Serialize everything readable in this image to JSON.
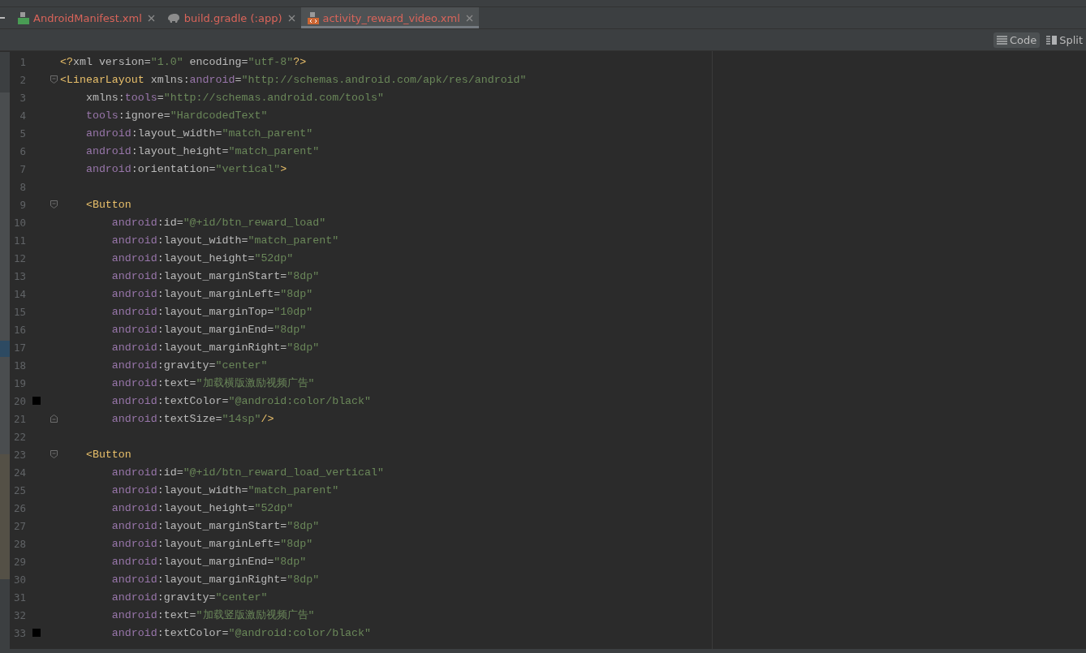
{
  "tabs": [
    {
      "label": "AndroidManifest.xml",
      "kind": "manifest",
      "selected": false
    },
    {
      "label": "build.gradle (:app)",
      "kind": "gradle",
      "selected": false
    },
    {
      "label": "activity_reward_video.xml",
      "kind": "xml",
      "selected": true
    }
  ],
  "view_modes": [
    {
      "label": "Code",
      "kind": "code",
      "selected": true
    },
    {
      "label": "Split",
      "kind": "split",
      "selected": false
    }
  ],
  "lines": [
    {
      "number": "1",
      "tokens": [
        {
          "kind": "punct",
          "text": "<?"
        },
        {
          "kind": "attr",
          "text": "xml version"
        },
        {
          "kind": "eq",
          "text": "="
        },
        {
          "kind": "value",
          "text": "\"1.0\""
        },
        {
          "kind": "attr",
          "text": " encoding"
        },
        {
          "kind": "eq",
          "text": "="
        },
        {
          "kind": "value",
          "text": "\"utf-8\""
        },
        {
          "kind": "punct",
          "text": "?>"
        }
      ]
    },
    {
      "number": "2",
      "fold_start": true,
      "tokens": [
        {
          "kind": "punct",
          "text": "<"
        },
        {
          "kind": "tag",
          "text": "LinearLayout"
        },
        {
          "kind": "attr",
          "text": " xmlns:"
        },
        {
          "kind": "ns",
          "text": "android"
        },
        {
          "kind": "eq",
          "text": "="
        },
        {
          "kind": "value",
          "text": "\"http://schemas.android.com/apk/res/android\""
        }
      ]
    },
    {
      "number": "3",
      "tokens": [
        {
          "kind": "attr",
          "text": "    xmlns:"
        },
        {
          "kind": "ns",
          "text": "tools"
        },
        {
          "kind": "eq",
          "text": "="
        },
        {
          "kind": "value",
          "text": "\"http://schemas.android.com/tools\""
        }
      ]
    },
    {
      "number": "4",
      "tokens": [
        {
          "kind": "ns",
          "text": "    tools"
        },
        {
          "kind": "attr",
          "text": ":ignore"
        },
        {
          "kind": "eq",
          "text": "="
        },
        {
          "kind": "value",
          "text": "\"HardcodedText\""
        }
      ]
    },
    {
      "number": "5",
      "tokens": [
        {
          "kind": "ns",
          "text": "    android"
        },
        {
          "kind": "attr",
          "text": ":layout_width"
        },
        {
          "kind": "eq",
          "text": "="
        },
        {
          "kind": "value",
          "text": "\"match_parent\""
        }
      ]
    },
    {
      "number": "6",
      "tokens": [
        {
          "kind": "ns",
          "text": "    android"
        },
        {
          "kind": "attr",
          "text": ":layout_height"
        },
        {
          "kind": "eq",
          "text": "="
        },
        {
          "kind": "value",
          "text": "\"match_parent\""
        }
      ]
    },
    {
      "number": "7",
      "tokens": [
        {
          "kind": "ns",
          "text": "    android"
        },
        {
          "kind": "attr",
          "text": ":orientation"
        },
        {
          "kind": "eq",
          "text": "="
        },
        {
          "kind": "value",
          "text": "\"vertical\""
        },
        {
          "kind": "punct",
          "text": ">"
        }
      ]
    },
    {
      "number": "8"
    },
    {
      "number": "9",
      "fold_start": true,
      "tokens": [
        {
          "kind": "punct",
          "text": "    <"
        },
        {
          "kind": "tag",
          "text": "Button"
        }
      ]
    },
    {
      "number": "10",
      "tokens": [
        {
          "kind": "ns",
          "text": "        android"
        },
        {
          "kind": "attr",
          "text": ":id"
        },
        {
          "kind": "eq",
          "text": "="
        },
        {
          "kind": "value",
          "text": "\"@+id/btn_reward_load\""
        }
      ]
    },
    {
      "number": "11",
      "tokens": [
        {
          "kind": "ns",
          "text": "        android"
        },
        {
          "kind": "attr",
          "text": ":layout_width"
        },
        {
          "kind": "eq",
          "text": "="
        },
        {
          "kind": "value",
          "text": "\"match_parent\""
        }
      ]
    },
    {
      "number": "12",
      "tokens": [
        {
          "kind": "ns",
          "text": "        android"
        },
        {
          "kind": "attr",
          "text": ":layout_height"
        },
        {
          "kind": "eq",
          "text": "="
        },
        {
          "kind": "value",
          "text": "\"52dp\""
        }
      ]
    },
    {
      "number": "13",
      "tokens": [
        {
          "kind": "ns",
          "text": "        android"
        },
        {
          "kind": "attr",
          "text": ":layout_marginStart"
        },
        {
          "kind": "eq",
          "text": "="
        },
        {
          "kind": "value",
          "text": "\"8dp\""
        }
      ]
    },
    {
      "number": "14",
      "tokens": [
        {
          "kind": "ns",
          "text": "        android"
        },
        {
          "kind": "attr",
          "text": ":layout_marginLeft"
        },
        {
          "kind": "eq",
          "text": "="
        },
        {
          "kind": "value",
          "text": "\"8dp\""
        }
      ]
    },
    {
      "number": "15",
      "tokens": [
        {
          "kind": "ns",
          "text": "        android"
        },
        {
          "kind": "attr",
          "text": ":layout_marginTop"
        },
        {
          "kind": "eq",
          "text": "="
        },
        {
          "kind": "value",
          "text": "\"10dp\""
        }
      ]
    },
    {
      "number": "16",
      "tokens": [
        {
          "kind": "ns",
          "text": "        android"
        },
        {
          "kind": "attr",
          "text": ":layout_marginEnd"
        },
        {
          "kind": "eq",
          "text": "="
        },
        {
          "kind": "value",
          "text": "\"8dp\""
        }
      ]
    },
    {
      "number": "17",
      "tokens": [
        {
          "kind": "ns",
          "text": "        android"
        },
        {
          "kind": "attr",
          "text": ":layout_marginRight"
        },
        {
          "kind": "eq",
          "text": "="
        },
        {
          "kind": "value",
          "text": "\"8dp\""
        }
      ]
    },
    {
      "number": "18",
      "tokens": [
        {
          "kind": "ns",
          "text": "        android"
        },
        {
          "kind": "attr",
          "text": ":gravity"
        },
        {
          "kind": "eq",
          "text": "="
        },
        {
          "kind": "value",
          "text": "\"center\""
        }
      ]
    },
    {
      "number": "19",
      "tokens": [
        {
          "kind": "ns",
          "text": "        android"
        },
        {
          "kind": "attr",
          "text": ":text"
        },
        {
          "kind": "eq",
          "text": "="
        },
        {
          "kind": "value",
          "text": "\"加载横版激励视频广告\""
        }
      ]
    },
    {
      "number": "20",
      "color": "#000000",
      "tokens": [
        {
          "kind": "ns",
          "text": "        android"
        },
        {
          "kind": "attr",
          "text": ":textColor"
        },
        {
          "kind": "eq",
          "text": "="
        },
        {
          "kind": "value",
          "text": "\"@android:color/black\""
        }
      ]
    },
    {
      "number": "21",
      "fold_end": true,
      "tokens": [
        {
          "kind": "ns",
          "text": "        android"
        },
        {
          "kind": "attr",
          "text": ":textSize"
        },
        {
          "kind": "eq",
          "text": "="
        },
        {
          "kind": "value",
          "text": "\"14sp\""
        },
        {
          "kind": "punct",
          "text": "/>"
        }
      ]
    },
    {
      "number": "22"
    },
    {
      "number": "23",
      "fold_start": true,
      "tokens": [
        {
          "kind": "punct",
          "text": "    <"
        },
        {
          "kind": "tag",
          "text": "Button"
        }
      ]
    },
    {
      "number": "24",
      "tokens": [
        {
          "kind": "ns",
          "text": "        android"
        },
        {
          "kind": "attr",
          "text": ":id"
        },
        {
          "kind": "eq",
          "text": "="
        },
        {
          "kind": "value",
          "text": "\"@+id/btn_reward_load_vertical\""
        }
      ]
    },
    {
      "number": "25",
      "tokens": [
        {
          "kind": "ns",
          "text": "        android"
        },
        {
          "kind": "attr",
          "text": ":layout_width"
        },
        {
          "kind": "eq",
          "text": "="
        },
        {
          "kind": "value",
          "text": "\"match_parent\""
        }
      ]
    },
    {
      "number": "26",
      "tokens": [
        {
          "kind": "ns",
          "text": "        android"
        },
        {
          "kind": "attr",
          "text": ":layout_height"
        },
        {
          "kind": "eq",
          "text": "="
        },
        {
          "kind": "value",
          "text": "\"52dp\""
        }
      ]
    },
    {
      "number": "27",
      "tokens": [
        {
          "kind": "ns",
          "text": "        android"
        },
        {
          "kind": "attr",
          "text": ":layout_marginStart"
        },
        {
          "kind": "eq",
          "text": "="
        },
        {
          "kind": "value",
          "text": "\"8dp\""
        }
      ]
    },
    {
      "number": "28",
      "tokens": [
        {
          "kind": "ns",
          "text": "        android"
        },
        {
          "kind": "attr",
          "text": ":layout_marginLeft"
        },
        {
          "kind": "eq",
          "text": "="
        },
        {
          "kind": "value",
          "text": "\"8dp\""
        }
      ]
    },
    {
      "number": "29",
      "tokens": [
        {
          "kind": "ns",
          "text": "        android"
        },
        {
          "kind": "attr",
          "text": ":layout_marginEnd"
        },
        {
          "kind": "eq",
          "text": "="
        },
        {
          "kind": "value",
          "text": "\"8dp\""
        }
      ]
    },
    {
      "number": "30",
      "tokens": [
        {
          "kind": "ns",
          "text": "        android"
        },
        {
          "kind": "attr",
          "text": ":layout_marginRight"
        },
        {
          "kind": "eq",
          "text": "="
        },
        {
          "kind": "value",
          "text": "\"8dp\""
        }
      ]
    },
    {
      "number": "31",
      "tokens": [
        {
          "kind": "ns",
          "text": "        android"
        },
        {
          "kind": "attr",
          "text": ":gravity"
        },
        {
          "kind": "eq",
          "text": "="
        },
        {
          "kind": "value",
          "text": "\"center\""
        }
      ]
    },
    {
      "number": "32",
      "tokens": [
        {
          "kind": "ns",
          "text": "        android"
        },
        {
          "kind": "attr",
          "text": ":text"
        },
        {
          "kind": "eq",
          "text": "="
        },
        {
          "kind": "value",
          "text": "\"加载竖版激励视频广告\""
        }
      ]
    },
    {
      "number": "33",
      "color": "#000000",
      "tokens": [
        {
          "kind": "ns",
          "text": "        android"
        },
        {
          "kind": "attr",
          "text": ":textColor"
        },
        {
          "kind": "eq",
          "text": "="
        },
        {
          "kind": "value",
          "text": "\"@android:color/black\""
        }
      ]
    }
  ]
}
